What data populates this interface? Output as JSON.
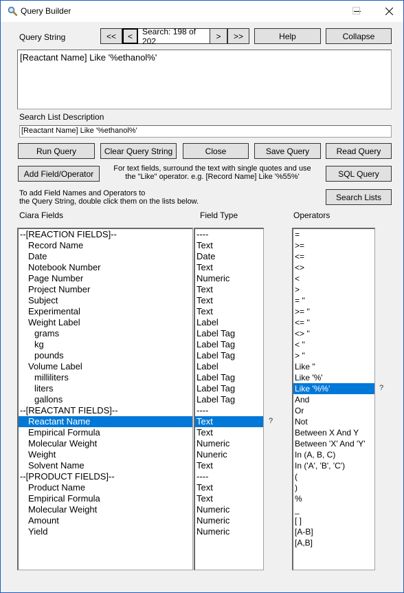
{
  "window": {
    "title": "Query Builder",
    "icon": "magnifier-icon",
    "controls": {
      "minimize": "—",
      "maximize": "☐",
      "close": "✕"
    }
  },
  "query_string": {
    "label": "Query String",
    "value": "[Reactant Name] Like '%ethanol%'"
  },
  "navigation": {
    "first": "<<",
    "prev": "<",
    "position": "Search: 198 of 202",
    "next": ">",
    "last": ">>"
  },
  "top_buttons": {
    "help": "Help",
    "collapse": "Collapse"
  },
  "search_list_description": {
    "label": "Search List Description",
    "value": "[Reactant Name] Like '%ethanol%'"
  },
  "action_buttons": {
    "run_query": "Run Query",
    "clear_query_string": "Clear Query String",
    "close": "Close",
    "save_query": "Save Query",
    "read_query": "Read Query",
    "add_field_operator": "Add Field/Operator",
    "sql_query": "SQL Query",
    "search_lists": "Search Lists"
  },
  "hint": {
    "line1": "For text fields, surround the text with single quotes and use",
    "line2": "the \"Like\" operator. e.g. [Record Name] Like '%55%'"
  },
  "instructions": {
    "line1": "To add Field Names and Operators to",
    "line2": "the Query String, double click them on the lists below."
  },
  "lists": {
    "fields_header": "Ciara Fields",
    "types_header": "Field Type",
    "operators_header": "Operators",
    "help_mark": "?",
    "fields": [
      {
        "name": "--[REACTION FIELDS]--",
        "type": "----",
        "indent": 0
      },
      {
        "name": "Record Name",
        "type": "Text",
        "indent": 1
      },
      {
        "name": "Date",
        "type": "Date",
        "indent": 1
      },
      {
        "name": "Notebook Number",
        "type": "Text",
        "indent": 1
      },
      {
        "name": "Page Number",
        "type": "Numeric",
        "indent": 1
      },
      {
        "name": "Project Number",
        "type": "Text",
        "indent": 1
      },
      {
        "name": "Subject",
        "type": "Text",
        "indent": 1
      },
      {
        "name": "Experimental",
        "type": "Text",
        "indent": 1
      },
      {
        "name": "Weight Label",
        "type": "Label",
        "indent": 1
      },
      {
        "name": "grams",
        "type": "Label Tag",
        "indent": 2
      },
      {
        "name": "kg",
        "type": "Label Tag",
        "indent": 2
      },
      {
        "name": "pounds",
        "type": "Label Tag",
        "indent": 2
      },
      {
        "name": "Volume Label",
        "type": "Label",
        "indent": 1
      },
      {
        "name": "milliliters",
        "type": "Label Tag",
        "indent": 2
      },
      {
        "name": "liters",
        "type": "Label Tag",
        "indent": 2
      },
      {
        "name": "gallons",
        "type": "Label Tag",
        "indent": 2
      },
      {
        "name": "--[REACTANT FIELDS]--",
        "type": "----",
        "indent": 0
      },
      {
        "name": "Reactant Name",
        "type": "Text",
        "indent": 1,
        "selected": true
      },
      {
        "name": "Empirical Formula",
        "type": "Text",
        "indent": 1
      },
      {
        "name": "Molecular Weight",
        "type": "Numeric",
        "indent": 1
      },
      {
        "name": "Weight",
        "type": "Nuneric",
        "indent": 1
      },
      {
        "name": "Solvent Name",
        "type": "Text",
        "indent": 1
      },
      {
        "name": "--[PRODUCT FIELDS]--",
        "type": "----",
        "indent": 0
      },
      {
        "name": "Product Name",
        "type": "Text",
        "indent": 1
      },
      {
        "name": "Empirical Formula",
        "type": "Text",
        "indent": 1
      },
      {
        "name": "Molecular Weight",
        "type": "Numeric",
        "indent": 1
      },
      {
        "name": "Amount",
        "type": "Numeric",
        "indent": 1
      },
      {
        "name": "Yield",
        "type": "Numeric",
        "indent": 1
      }
    ],
    "operators": [
      {
        "label": "="
      },
      {
        "label": ">="
      },
      {
        "label": "<="
      },
      {
        "label": "<>"
      },
      {
        "label": "<"
      },
      {
        "label": ">"
      },
      {
        "label": "= ''"
      },
      {
        "label": ">= ''"
      },
      {
        "label": "<= ''"
      },
      {
        "label": "<> ''"
      },
      {
        "label": "< ''"
      },
      {
        "label": "> ''"
      },
      {
        "label": "Like ''"
      },
      {
        "label": "Like '%'"
      },
      {
        "label": "Like '%%'",
        "selected": true
      },
      {
        "label": "And"
      },
      {
        "label": "Or"
      },
      {
        "label": "Not"
      },
      {
        "label": "Between X And Y"
      },
      {
        "label": "Between 'X' And 'Y'"
      },
      {
        "label": "In (A, B, C)"
      },
      {
        "label": "In ('A', 'B', 'C')"
      },
      {
        "label": "("
      },
      {
        "label": ")"
      },
      {
        "label": "%"
      },
      {
        "label": "_"
      },
      {
        "label": "[ ]"
      },
      {
        "label": "[A-B]"
      },
      {
        "label": "[A,B]"
      }
    ]
  },
  "colors": {
    "selection": "#0078d7",
    "window_border": "#1c5cbf",
    "background": "#f0f0f0"
  }
}
